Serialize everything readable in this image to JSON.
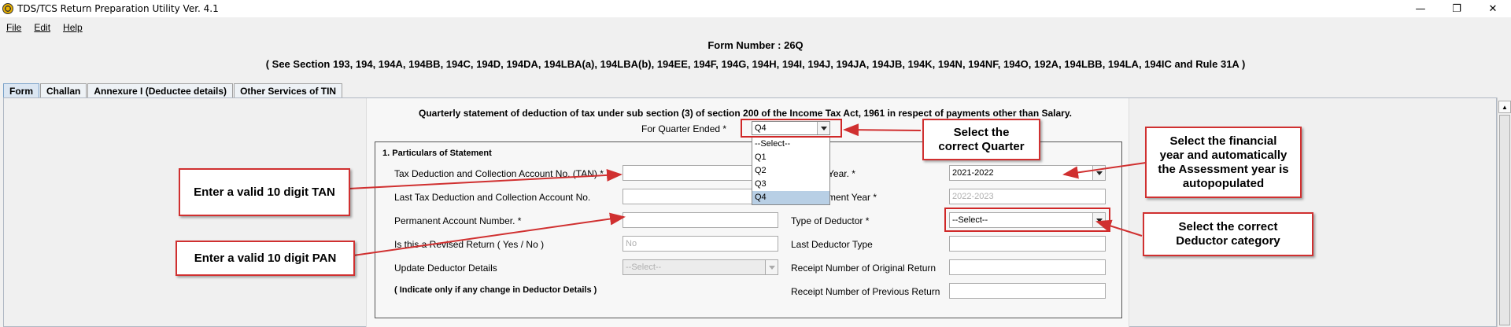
{
  "window": {
    "title": "TDS/TCS Return Preparation Utility Ver. 4.1",
    "controls": {
      "minimize": "—",
      "restore": "❐",
      "close": "✕"
    }
  },
  "menu": {
    "file": "File",
    "edit": "Edit",
    "help": "Help"
  },
  "header": {
    "form_number": "Form Number : 26Q",
    "sections": "( See Section 193, 194, 194A, 194BB, 194C, 194D, 194DA, 194LBA(a), 194LBA(b), 194EE, 194F, 194G, 194H, 194I, 194J, 194JA, 194JB, 194K, 194N, 194NF, 194O, 192A, 194LBB, 194LA, 194IC and Rule 31A )"
  },
  "tabs": [
    "Form",
    "Challan",
    "Annexure I (Deductee details)",
    "Other Services of TIN"
  ],
  "statement": {
    "title": "Quarterly statement of deduction of tax under sub section (3) of section 200 of the Income Tax Act, 1961 in respect of payments other than Salary.",
    "quarter_label": "For Quarter Ended *",
    "quarter_value": "Q4",
    "quarter_options": [
      "--Select--",
      "Q1",
      "Q2",
      "Q3",
      "Q4"
    ]
  },
  "particulars": {
    "title": "1. Particulars of Statement",
    "tan_label": "Tax Deduction and Collection Account No. (TAN) *",
    "tan_value": "",
    "last_tan_label": "Last Tax Deduction and Collection Account No.",
    "last_tan_value": "",
    "pan_label": "Permanent Account Number. *",
    "pan_value": "",
    "revised_label": "Is this a Revised Return ( Yes / No )",
    "revised_value": "No",
    "update_label": "Update Deductor Details",
    "update_value": "--Select--",
    "indicate_note": "( Indicate only if any change in Deductor Details )",
    "fy_label": "Year. *",
    "fy_value": "2021-2022",
    "ay_label": "ment Year *",
    "ay_value": "2022-2023",
    "deductor_type_label": "Type of Deductor *",
    "deductor_type_value": "--Select--",
    "last_deductor_type_label": "Last Deductor Type",
    "last_deductor_type_value": "",
    "receipt_original_label": "Receipt Number of Original Return",
    "receipt_original_value": "",
    "receipt_previous_label": "Receipt Number of Previous Return",
    "receipt_previous_value": ""
  },
  "annotations": {
    "tan": "Enter a valid 10 digit TAN",
    "pan": "Enter a valid 10 digit PAN",
    "quarter_line1": "Select the",
    "quarter_line2": "correct Quarter",
    "fy_line1": "Select the financial",
    "fy_line2": "year and automatically",
    "fy_line3": "the Assessment year is",
    "fy_line4": "autopopulated",
    "deductor_line1": "Select the correct",
    "deductor_line2": "Deductor category"
  },
  "colors": {
    "annotation_red": "#d03030",
    "selected_option": "#b8cfe5"
  }
}
